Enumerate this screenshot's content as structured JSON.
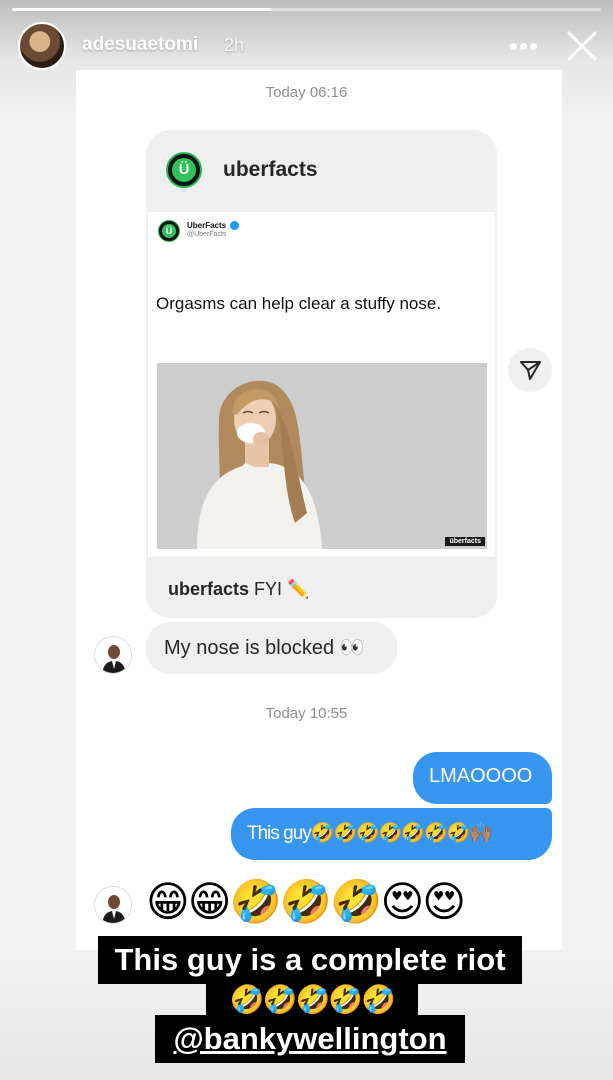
{
  "story": {
    "progress": 0.44
  },
  "header": {
    "username": "adesuaetomi",
    "time": "2h",
    "more_icon": "more-horizontal-icon",
    "close_icon": "close-icon"
  },
  "chat": {
    "timestamp_1": "Today 06:16",
    "shared_post": {
      "account": "uberfacts",
      "tweet_name": "UberFacts",
      "tweet_handle": "@UberFacts",
      "tweet_text": "Orgasms can help clear a stuffy nose.",
      "watermark": "überfacts",
      "caption_user": "uberfacts",
      "caption_text": " FYI ✏️"
    },
    "message_1": "My nose is blocked 👀",
    "timestamp_2": "Today 10:55",
    "outgoing_1": "LMAOOOO",
    "outgoing_2": "This guy🤣🤣🤣🤣🤣🤣🤣🙌🏽",
    "emoji_message": "😁😁🤣🤣🤣😍😍"
  },
  "overlay": {
    "line_1": "This guy is a complete riot",
    "line_2": "🤣🤣🤣🤣🤣",
    "line_3": "@bankywellington"
  },
  "colors": {
    "outgoing_bubble": "#3797f0",
    "incoming_bubble": "#efefef",
    "brand_green": "#2fc25b"
  }
}
